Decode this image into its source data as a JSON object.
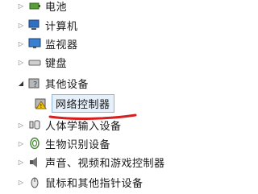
{
  "tree": {
    "items": [
      {
        "label": "电池",
        "icon": "battery-icon",
        "state": "collapsed"
      },
      {
        "label": "计算机",
        "icon": "computer-icon",
        "state": "collapsed"
      },
      {
        "label": "监视器",
        "icon": "monitor-icon",
        "state": "collapsed"
      },
      {
        "label": "键盘",
        "icon": "keyboard-icon",
        "state": "collapsed"
      },
      {
        "label": "其他设备",
        "icon": "unknown-device-icon",
        "state": "expanded"
      },
      {
        "label": "网络控制器",
        "icon": "warning-device-icon",
        "state": "child",
        "selected": true
      },
      {
        "label": "人体学输入设备",
        "icon": "hid-icon",
        "state": "collapsed"
      },
      {
        "label": "生物识别设备",
        "icon": "fingerprint-icon",
        "state": "collapsed"
      },
      {
        "label": "声音、视频和游戏控制器",
        "icon": "speaker-icon",
        "state": "collapsed"
      },
      {
        "label": "鼠标和其他指针设备",
        "icon": "mouse-icon",
        "state": "collapsed"
      }
    ]
  },
  "annotation_color": "#d42020"
}
